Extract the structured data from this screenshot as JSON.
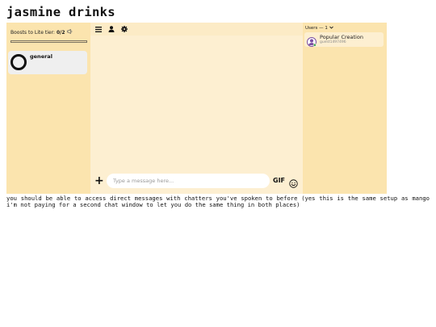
{
  "page": {
    "title": "jasmine drinks",
    "notes": "you should be able to access direct messages with chatters you've spoken to before (yes this is the same setup as mango i'm not paying for a second chat window to let you do the same thing in both places)"
  },
  "sidebar": {
    "boost_label": "Boosts to Lite tier:",
    "boost_count": "0/2",
    "boost_icon": "megaphone-icon",
    "boost_progress": 0,
    "channels": [
      {
        "name": "general",
        "icon": "ring-icon"
      }
    ]
  },
  "toolbar": {
    "icons": [
      "menu-icon",
      "user-icon",
      "gear-icon"
    ]
  },
  "composer": {
    "add_icon": "plus-icon",
    "placeholder": "Type a message here...",
    "gif_label": "GIF",
    "emoji_icon": "smiley-icon"
  },
  "users": {
    "header": "Users — 1",
    "list": [
      {
        "name": "Popular Creation",
        "handle": "guest1497496",
        "status_color": "#3ba55d",
        "avatar_color": "#7b4fa3"
      }
    ]
  },
  "colors": {
    "panel": "#fbe4ae",
    "chat_bg": "#fdefd1",
    "toolbar": "#fcebc6",
    "channel_card": "#efefef"
  }
}
